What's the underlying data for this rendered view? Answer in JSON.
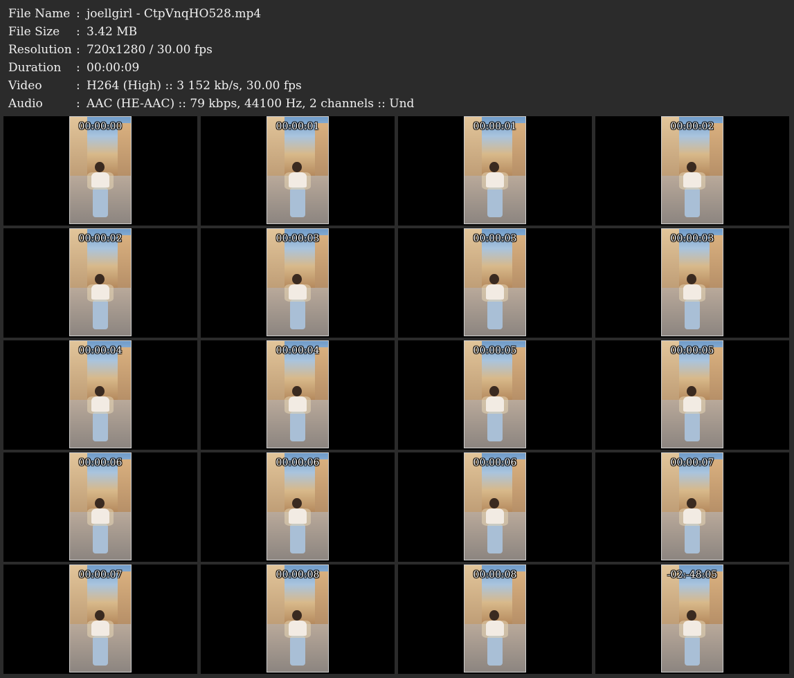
{
  "file_info": [
    {
      "label": "File Name",
      "value": "joellgirl - CtpVnqHO528.mp4"
    },
    {
      "label": "File Size",
      "value": "3.42 MB"
    },
    {
      "label": "Resolution",
      "value": "720x1280 / 30.00 fps"
    },
    {
      "label": "Duration",
      "value": "00:00:09"
    },
    {
      "label": "Video",
      "value": "H264 (High) :: 3 152 kb/s, 30.00 fps"
    },
    {
      "label": "Audio",
      "value": "AAC (HE-AAC) :: 79 kbps, 44100 Hz, 2 channels :: Und"
    }
  ],
  "separator": ":",
  "thumbnails": [
    {
      "timestamp": "00:00:00"
    },
    {
      "timestamp": "00:00:01"
    },
    {
      "timestamp": "00:00:01"
    },
    {
      "timestamp": "00:00:02"
    },
    {
      "timestamp": "00:00:02"
    },
    {
      "timestamp": "00:00:03"
    },
    {
      "timestamp": "00:00:03"
    },
    {
      "timestamp": "00:00:03"
    },
    {
      "timestamp": "00:00:04"
    },
    {
      "timestamp": "00:00:04"
    },
    {
      "timestamp": "00:00:05"
    },
    {
      "timestamp": "00:00:05"
    },
    {
      "timestamp": "00:00:06"
    },
    {
      "timestamp": "00:00:06"
    },
    {
      "timestamp": "00:00:06"
    },
    {
      "timestamp": "00:00:07"
    },
    {
      "timestamp": "00:00:07"
    },
    {
      "timestamp": "00:00:08"
    },
    {
      "timestamp": "00:00:08"
    },
    {
      "timestamp": "-02:-48:05"
    }
  ],
  "colors": {
    "background": "#2b2b2b",
    "cell_background": "#000000",
    "text": "#f0f0f0"
  }
}
